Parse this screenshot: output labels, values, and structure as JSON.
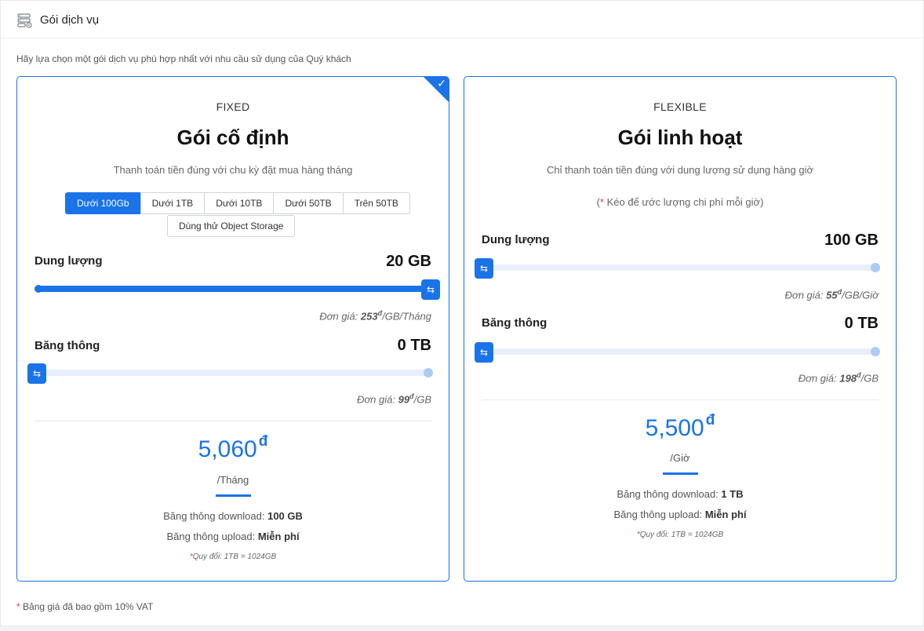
{
  "header": {
    "title": "Gói dịch vụ",
    "icon": "server-settings-icon"
  },
  "intro": "Hãy lựa chọn một gói dịch vụ phù hợp nhất với nhu cầu sử dụng của Quý khách",
  "footer_note": "Bảng giá đã bao gồm 10% VAT",
  "colors": {
    "accent": "#1a73e8",
    "required": "#e0403a"
  },
  "fixed": {
    "type": "FIXED",
    "name": "Gói cố định",
    "desc": "Thanh toán tiền đúng với chu kỳ đặt mua hàng tháng",
    "selected": true,
    "tiers": [
      "Dưới 100Gb",
      "Dưới 1TB",
      "Dưới 10TB",
      "Dưới 50TB",
      "Trên 50TB"
    ],
    "active_tier": "Dưới 100Gb",
    "trial": "Dùng thử Object Storage",
    "storage": {
      "label": "Dung lượng",
      "value": "20 GB",
      "level": 1.0,
      "unit_price_label": "Đơn giá:",
      "unit_price": "253",
      "currency": "đ",
      "unit_price_unit": "/GB/Tháng"
    },
    "bandwidth": {
      "label": "Băng thông",
      "value": "0 TB",
      "level": 0.0,
      "unit_price_label": "Đơn giá:",
      "unit_price": "99",
      "currency": "đ",
      "unit_price_unit": "/GB"
    },
    "price": "5,060",
    "currency": "đ",
    "period": "/Tháng",
    "download_label": "Băng thông download:",
    "download_value": "100 GB",
    "upload_label": "Băng thông upload:",
    "upload_value": "Miễn phí",
    "conversion": "Quy đổi: 1TB = 1024GB"
  },
  "flexible": {
    "type": "FLEXIBLE",
    "name": "Gói linh hoạt",
    "desc": "Chỉ thanh toán tiền đúng với dung lượng sử dụng hàng giờ",
    "drag_note": "Kéo để ước lượng chi phí mỗi giờ)",
    "storage": {
      "label": "Dung lượng",
      "value": "100 GB",
      "level": 0.0,
      "unit_price_label": "Đơn giá:",
      "unit_price": "55",
      "currency": "đ",
      "unit_price_unit": "/GB/Giờ"
    },
    "bandwidth": {
      "label": "Băng thông",
      "value": "0 TB",
      "level": 0.0,
      "unit_price_label": "Đơn giá:",
      "unit_price": "198",
      "currency": "đ",
      "unit_price_unit": "/GB"
    },
    "price": "5,500",
    "currency": "đ",
    "period": "/Giờ",
    "download_label": "Băng thông download:",
    "download_value": "1 TB",
    "upload_label": "Băng thông upload:",
    "upload_value": "Miễn phí",
    "conversion": "Quy đổi: 1TB = 1024GB"
  }
}
